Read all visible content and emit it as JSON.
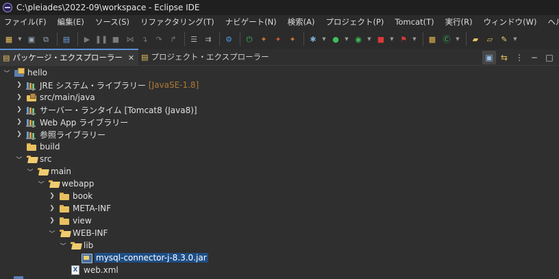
{
  "window": {
    "title": "C:\\pleiades\\2022-09\\workspace - Eclipse IDE"
  },
  "menubar": {
    "items": [
      "ファイル(F)",
      "編集(E)",
      "ソース(S)",
      "リファクタリング(T)",
      "ナビゲート(N)",
      "検索(A)",
      "プロジェクト(P)",
      "Tomcat(T)",
      "実行(R)",
      "ウィンドウ(W)",
      "ヘルプ(H)"
    ]
  },
  "view_tabs": {
    "package_explorer": "パッケージ・エクスプローラー",
    "project_explorer": "プロジェクト・エクスプローラー"
  },
  "tree": {
    "project": "hello",
    "jre_library": "JRE システム・ライブラリー",
    "jre_decoration": "[JavaSE-1.8]",
    "src_main_java": "src/main/java",
    "server_runtime": "サーバー・ランタイム [Tomcat8 (Java8)]",
    "webapp_libraries": "Web App ライブラリー",
    "referenced_libraries": "参照ライブラリー",
    "build": "build",
    "src": "src",
    "main": "main",
    "webapp": "webapp",
    "book": "book",
    "meta_inf": "META-INF",
    "view": "view",
    "web_inf": "WEB-INF",
    "lib": "lib",
    "jar": "mysql-connector-j-8.3.0.jar",
    "web_xml": "web.xml"
  },
  "colors": {
    "selection": "#1e4e86",
    "active_tab_accent": "#5a8fd6",
    "decoration": "#b07a35"
  }
}
